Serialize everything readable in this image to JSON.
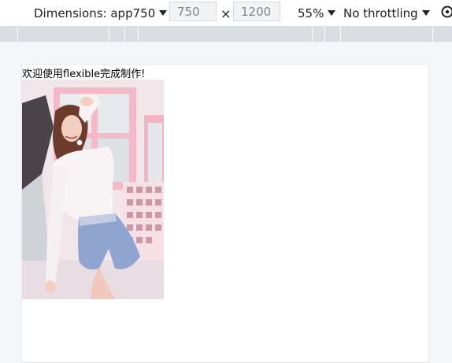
{
  "toolbar": {
    "dimensions_label": "Dimensions: app750",
    "width_value": "750",
    "times": "×",
    "height_value": "1200",
    "zoom_label": "55%",
    "throttle_label": "No throttling"
  },
  "page": {
    "welcome_text": "欢迎使用flexible完成制作!"
  },
  "colors": {
    "ruler": "#dadde2",
    "toolbar_bg": "#ffffff",
    "canvas_bg": "#f5f6f7"
  },
  "icons": {
    "dropdown": "caret-down-icon",
    "settings": "settings-icon"
  }
}
